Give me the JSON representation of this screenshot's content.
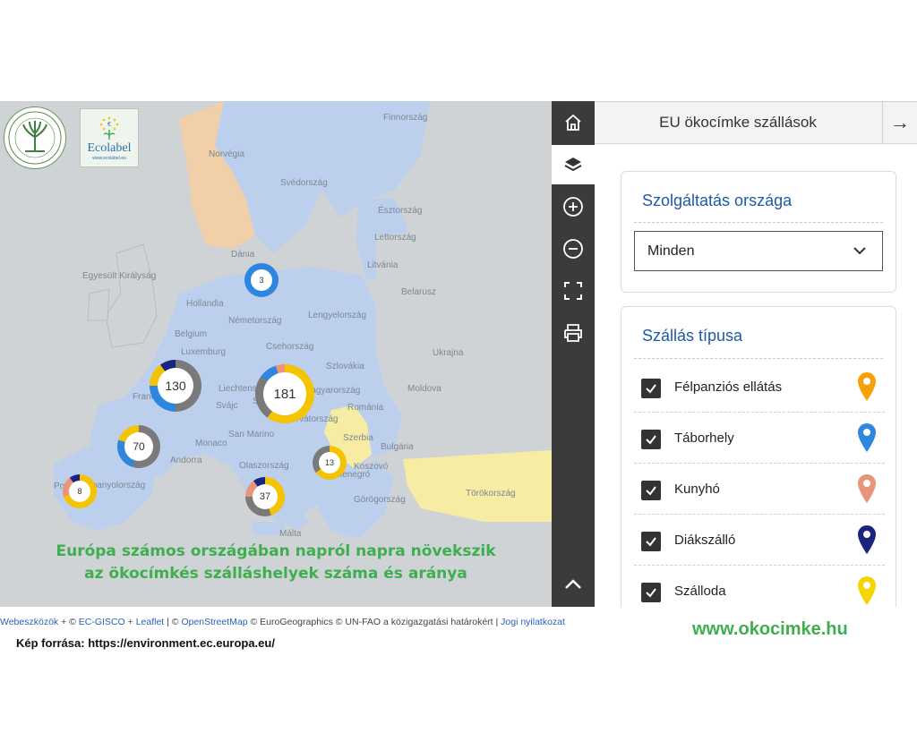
{
  "map": {
    "country_labels": [
      "Finnország",
      "Norvégia",
      "Svédország",
      "Észtország",
      "Lettország",
      "Litvánia",
      "Dánia",
      "Egyesült Királyság",
      "Hollandia",
      "Németország",
      "Lengyelország",
      "Belarusz",
      "Belgium",
      "Luxemburg",
      "Csehország",
      "Szlovákia",
      "Ukrajna",
      "Franciaország",
      "Liechtenstein",
      "Ausztria",
      "Magyarország",
      "Moldova",
      "Svájc",
      "Szlovénia",
      "Horvátország",
      "Románia",
      "San Marino",
      "Szerbia",
      "Bulgária",
      "Monaco",
      "Andorra",
      "Koszovó",
      "Montenegró",
      "Spanyolország",
      "Olaszország",
      "Portugália",
      "Törökország",
      "Görögország",
      "Málta"
    ],
    "clusters": [
      {
        "count": "3",
        "segments": [
          {
            "color": "#2e86de",
            "frac": 1.0
          }
        ]
      },
      {
        "count": "130",
        "segments": [
          {
            "color": "#7a7a7a",
            "frac": 0.5
          },
          {
            "color": "#2e86de",
            "frac": 0.25
          },
          {
            "color": "#f5c400",
            "frac": 0.15
          },
          {
            "color": "#1a237e",
            "frac": 0.1
          }
        ]
      },
      {
        "count": "181",
        "segments": [
          {
            "color": "#f5c400",
            "frac": 0.6
          },
          {
            "color": "#7a7a7a",
            "frac": 0.25
          },
          {
            "color": "#2e86de",
            "frac": 0.1
          },
          {
            "color": "#e8957a",
            "frac": 0.05
          }
        ]
      },
      {
        "count": "70",
        "segments": [
          {
            "color": "#7a7a7a",
            "frac": 0.55
          },
          {
            "color": "#2e86de",
            "frac": 0.25
          },
          {
            "color": "#f5c400",
            "frac": 0.2
          }
        ]
      },
      {
        "count": "13",
        "segments": [
          {
            "color": "#f5c400",
            "frac": 0.65
          },
          {
            "color": "#7a7a7a",
            "frac": 0.35
          }
        ]
      },
      {
        "count": "37",
        "segments": [
          {
            "color": "#f5c400",
            "frac": 0.45
          },
          {
            "color": "#7a7a7a",
            "frac": 0.3
          },
          {
            "color": "#e8957a",
            "frac": 0.15
          },
          {
            "color": "#1a237e",
            "frac": 0.1
          }
        ]
      },
      {
        "count": "8",
        "segments": [
          {
            "color": "#f5c400",
            "frac": 0.7
          },
          {
            "color": "#e8957a",
            "frac": 0.2
          },
          {
            "color": "#1a237e",
            "frac": 0.1
          }
        ]
      }
    ],
    "logos": {
      "left_icon": "tree-emblem-icon",
      "left_ring_text": "KÖRNYEZETBARÁT TERMÉK",
      "right_title": "Ecolabel",
      "right_sub": "www.ecolabel.eu"
    },
    "caption_line1": "Európa számos országában napról napra növekszik",
    "caption_line2": "az ökocímkés szálláshelyek száma és aránya"
  },
  "toolbar": {
    "items": [
      {
        "name": "home-icon",
        "active": false
      },
      {
        "name": "layers-icon",
        "active": true
      },
      {
        "name": "zoom-in-icon",
        "active": false
      },
      {
        "name": "zoom-out-icon",
        "active": false
      },
      {
        "name": "fullscreen-icon",
        "active": false
      },
      {
        "name": "print-icon",
        "active": false
      },
      {
        "name": "chevron-up-icon",
        "active": false
      }
    ]
  },
  "panel": {
    "title": "EU ökocímke szállások",
    "arrow": "→",
    "country_section": {
      "title": "Szolgáltatás országa",
      "select_value": "Minden"
    },
    "type_section": {
      "title": "Szállás típusa",
      "options": [
        {
          "label": "Félpanziós ellátás",
          "checked": true,
          "pin_color": "#f5a20a"
        },
        {
          "label": "Táborhely",
          "checked": true,
          "pin_color": "#2e86de"
        },
        {
          "label": "Kunyhó",
          "checked": true,
          "pin_color": "#e8957a"
        },
        {
          "label": "Diákszálló",
          "checked": true,
          "pin_color": "#1a237e"
        },
        {
          "label": "Szálloda",
          "checked": true,
          "pin_color": "#f5d400"
        }
      ]
    }
  },
  "footer": {
    "attribution_parts": [
      {
        "text": "Webeszközök",
        "link": true
      },
      {
        "text": " + © ",
        "link": false
      },
      {
        "text": "EC-GISCO",
        "link": true
      },
      {
        "text": " + ",
        "link": false
      },
      {
        "text": "Leaflet",
        "link": true
      },
      {
        "text": " | © ",
        "link": false
      },
      {
        "text": "OpenStreetMap",
        "link": true
      },
      {
        "text": " © EuroGeographics © UN-FAO a közigazgatási határokért | ",
        "link": false
      },
      {
        "text": "Jogi nyilatkozat",
        "link": true
      }
    ],
    "source": "Kép forrása:  https://environment.ec.europa.eu/",
    "website": "www.okocimke.hu"
  }
}
